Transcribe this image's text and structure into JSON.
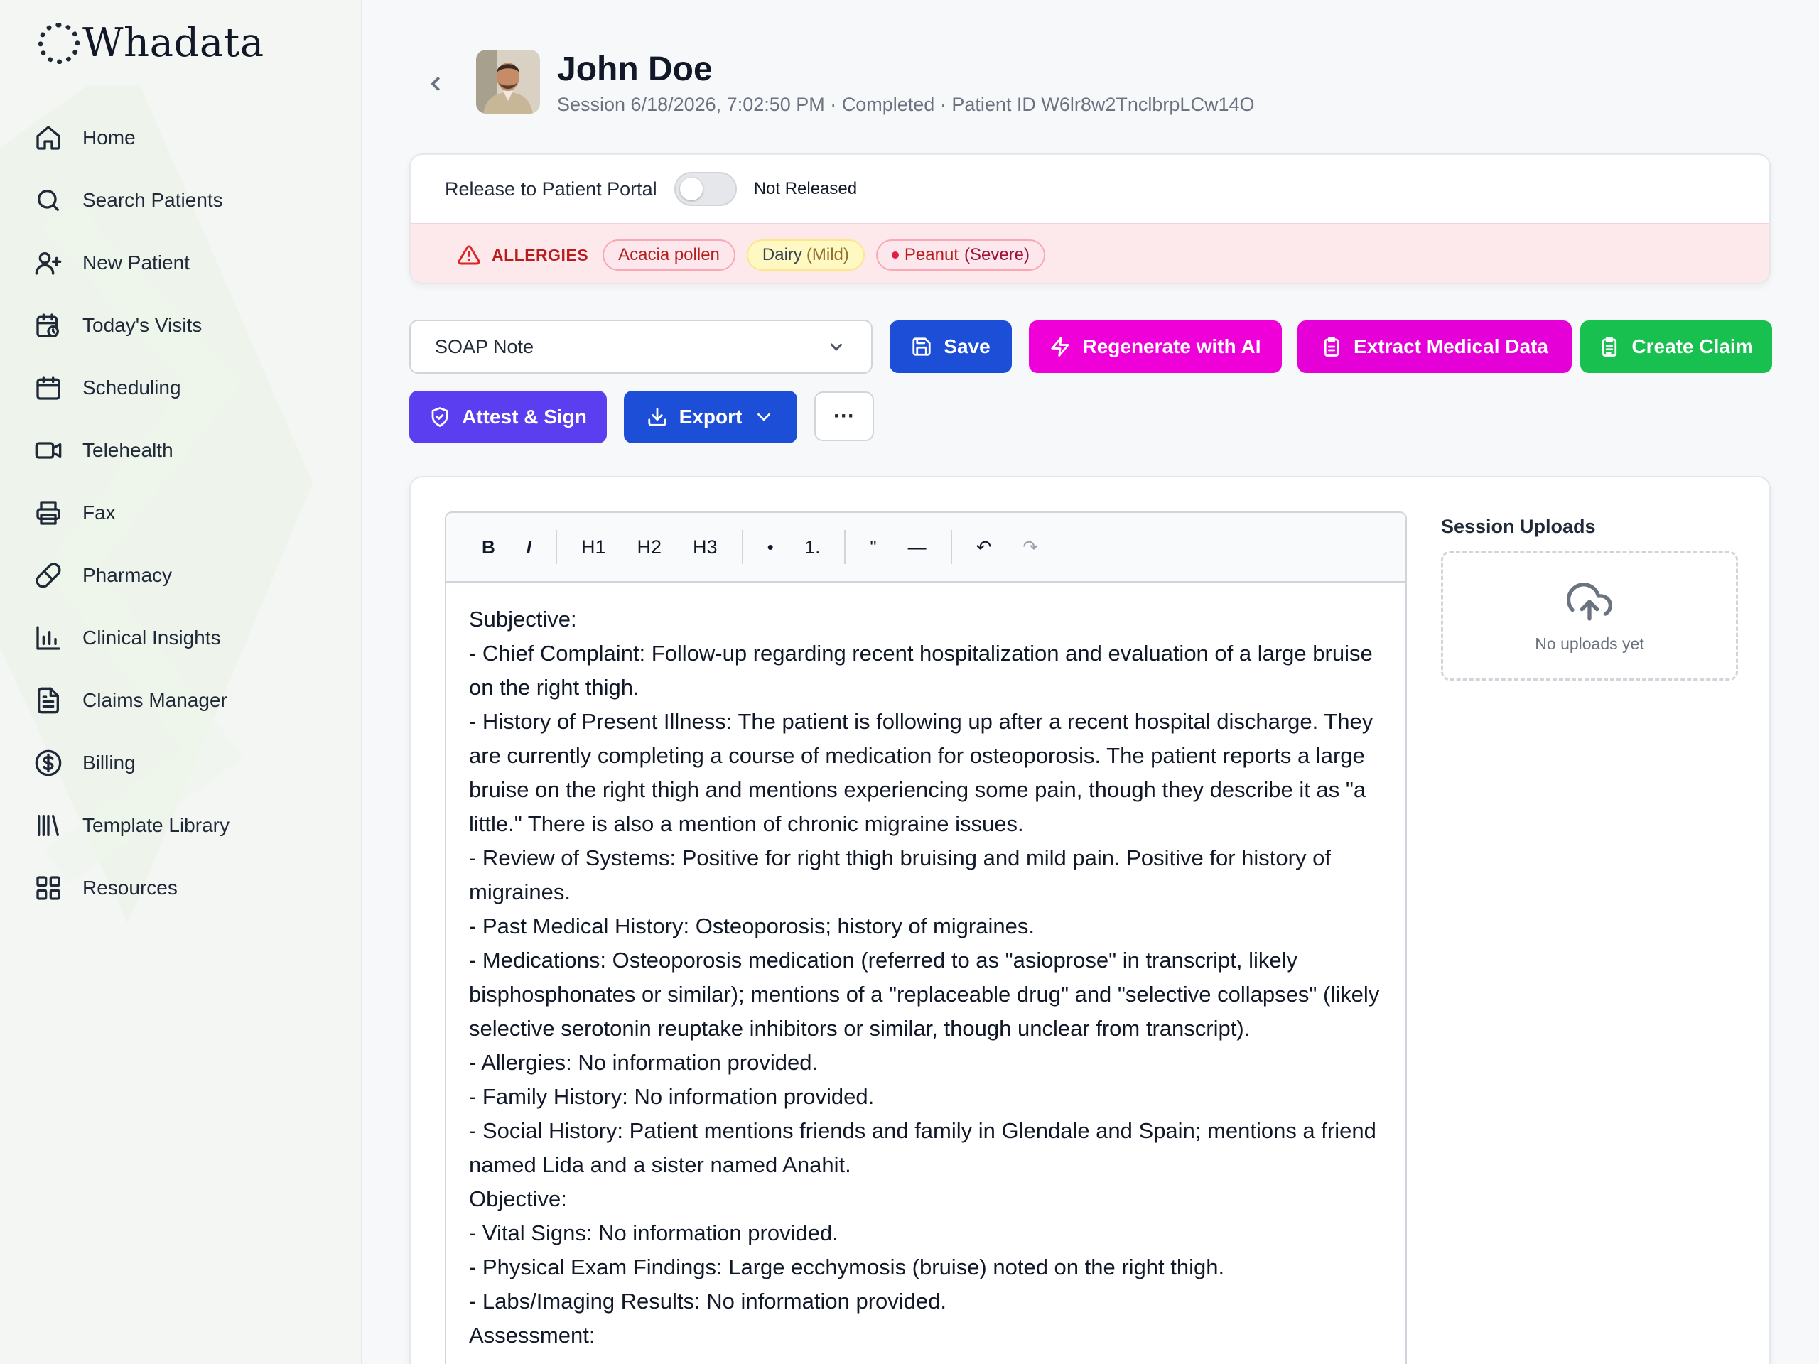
{
  "app": {
    "name": "Whadata"
  },
  "sidebar": {
    "items": [
      {
        "label": "Home",
        "icon": "home-icon"
      },
      {
        "label": "Search Patients",
        "icon": "search-icon"
      },
      {
        "label": "New Patient",
        "icon": "user-plus-icon"
      },
      {
        "label": "Today's Visits",
        "icon": "calendar-clock-icon"
      },
      {
        "label": "Scheduling",
        "icon": "calendar-icon"
      },
      {
        "label": "Telehealth",
        "icon": "video-icon"
      },
      {
        "label": "Fax",
        "icon": "printer-icon"
      },
      {
        "label": "Pharmacy",
        "icon": "pill-icon"
      },
      {
        "label": "Clinical Insights",
        "icon": "bar-chart-icon"
      },
      {
        "label": "Claims Manager",
        "icon": "file-text-icon"
      },
      {
        "label": "Billing",
        "icon": "dollar-circle-icon"
      },
      {
        "label": "Template Library",
        "icon": "library-icon"
      },
      {
        "label": "Resources",
        "icon": "grid-icon"
      }
    ]
  },
  "header": {
    "patient_name": "John Doe",
    "session_meta": "Session 6/18/2026, 7:02:50 PM · Completed · Patient ID W6lr8w2TnclbrpLCw14O"
  },
  "portal": {
    "label": "Release to Patient Portal",
    "status": "Not Released",
    "released": false
  },
  "allergies": {
    "title": "ALLERGIES",
    "items": [
      {
        "name": "Acacia pollen",
        "severity": ""
      },
      {
        "name": "Dairy",
        "severity": "(Mild)"
      },
      {
        "name": "Peanut",
        "severity": "(Severe)"
      }
    ]
  },
  "actions": {
    "template_select": "SOAP Note",
    "save": "Save",
    "regenerate": "Regenerate with AI",
    "extract": "Extract Medical Data",
    "create_claim": "Create Claim",
    "attest": "Attest & Sign",
    "export": "Export",
    "more": "···"
  },
  "colors": {
    "save": "#1d4ed8",
    "regenerate": "#f000d8",
    "extract": "#e600d8",
    "create_claim": "#17c04f",
    "attest": "#5b3ef0"
  },
  "toolbar": {
    "bold": "B",
    "italic": "I",
    "h1": "H1",
    "h2": "H2",
    "h3": "H3",
    "bullet": "•",
    "ordered": "1.",
    "quote": "\"",
    "rule": "—",
    "undo": "↶",
    "redo": "↷"
  },
  "note": {
    "content": "Subjective:\n- Chief Complaint: Follow-up regarding recent hospitalization and evaluation of a large bruise on the right thigh.\n- History of Present Illness: The patient is following up after a recent hospital discharge. They are currently completing a course of medication for osteoporosis. The patient reports a large bruise on the right thigh and mentions experiencing some pain, though they describe it as \"a little.\" There is also a mention of chronic migraine issues.\n- Review of Systems: Positive for right thigh bruising and mild pain. Positive for history of migraines.\n- Past Medical History: Osteoporosis; history of migraines.\n- Medications: Osteoporosis medication (referred to as \"asioprose\" in transcript, likely bisphosphonates or similar); mentions of a \"replaceable drug\" and \"selective collapses\" (likely selective serotonin reuptake inhibitors or similar, though unclear from transcript).\n- Allergies: No information provided.\n- Family History: No information provided.\n- Social History: Patient mentions friends and family in Glendale and Spain; mentions a friend named Lida and a sister named Anahit.\nObjective:\n- Vital Signs: No information provided.\n- Physical Exam Findings: Large ecchymosis (bruise) noted on the right thigh.\n- Labs/Imaging Results: No information provided.\nAssessment:"
  },
  "uploads": {
    "title": "Session Uploads",
    "empty": "No uploads yet"
  }
}
